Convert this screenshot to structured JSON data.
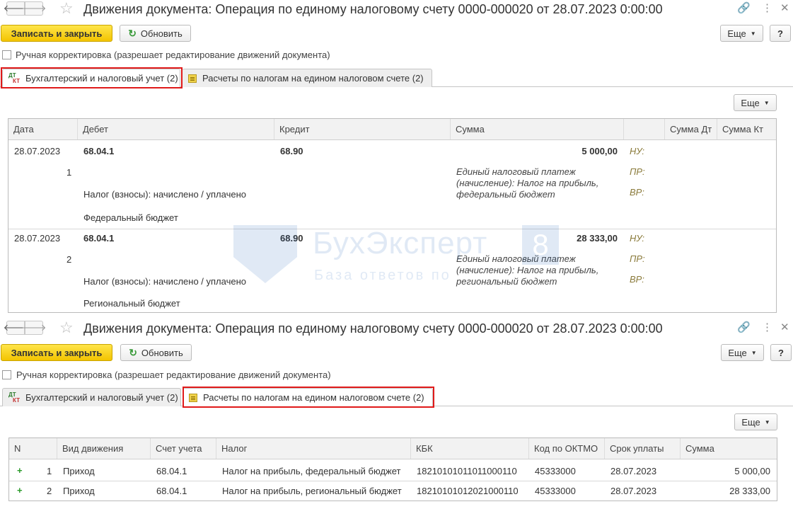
{
  "window": {
    "title": "Движения документа: Операция по единому налоговому счету 0000-000020 от 28.07.2023 0:00:00"
  },
  "toolbar": {
    "save_close": "Записать и закрыть",
    "refresh": "Обновить",
    "more": "Еще",
    "help": "?"
  },
  "manual_edit_label": "Ручная корректировка (разрешает редактирование движений документа)",
  "tabs": [
    {
      "label": "Бухгалтерский и налоговый учет (2)"
    },
    {
      "label": "Расчеты по налогам на едином налоговом счете (2)"
    }
  ],
  "grid_more": "Еще",
  "accounting": {
    "columns": [
      "Дата",
      "Дебет",
      "Кредит",
      "Сумма",
      "",
      "Сумма Дт",
      "Сумма Кт"
    ],
    "rows": [
      {
        "date": "28.07.2023",
        "num": "1",
        "debit": "68.04.1",
        "debit_sub1": "Налог (взносы): начислено / уплачено",
        "debit_sub2": "Федеральный бюджет",
        "credit": "68.90",
        "amount": "5 000,00",
        "desc1": "Единый налоговый платеж",
        "desc2": "(начисление): Налог на прибыль,",
        "desc3": "федеральный бюджет",
        "nu": "НУ:",
        "pr": "ПР:",
        "vr": "ВР:"
      },
      {
        "date": "28.07.2023",
        "num": "2",
        "debit": "68.04.1",
        "debit_sub1": "Налог (взносы): начислено / уплачено",
        "debit_sub2": "Региональный бюджет",
        "credit": "68.90",
        "amount": "28 333,00",
        "desc1": "Единый налоговый платеж",
        "desc2": "(начисление): Налог на прибыль,",
        "desc3": "региональный бюджет",
        "nu": "НУ:",
        "pr": "ПР:",
        "vr": "ВР:"
      }
    ]
  },
  "watermark": {
    "brand": "БухЭксперт",
    "num": "8",
    "sub": "База ответов по"
  },
  "tax": {
    "columns": [
      "N",
      "Вид движения",
      "Счет учета",
      "Налог",
      "КБК",
      "Код по ОКТМО",
      "Срок уплаты",
      "Сумма"
    ],
    "rows": [
      {
        "n": "1",
        "kind": "Приход",
        "account": "68.04.1",
        "tax": "Налог на прибыль, федеральный бюджет",
        "kbk": "18210101011011000110",
        "oktmo": "45333000",
        "due": "28.07.2023",
        "sum": "5 000,00"
      },
      {
        "n": "2",
        "kind": "Приход",
        "account": "68.04.1",
        "tax": "Налог на прибыль, региональный бюджет",
        "kbk": "18210101012021000110",
        "oktmo": "45333000",
        "due": "28.07.2023",
        "sum": "28 333,00"
      }
    ]
  }
}
